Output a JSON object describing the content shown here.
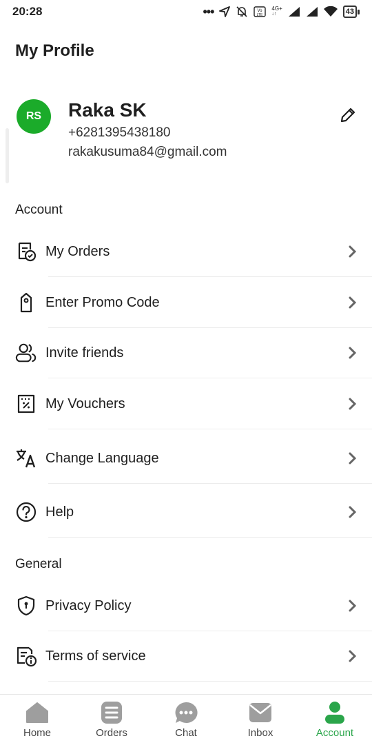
{
  "status_bar": {
    "time": "20:28",
    "battery": "43",
    "network": "4G+"
  },
  "page": {
    "title": "My Profile"
  },
  "profile": {
    "initials": "RS",
    "name": "Raka SK",
    "phone": "+6281395438180",
    "email": "rakakusuma84@gmail.com",
    "avatar_color": "#1bab2a"
  },
  "sections": {
    "account": "Account",
    "general": "General"
  },
  "account_items": [
    {
      "label": "My Orders",
      "icon": "orders-check-icon"
    },
    {
      "label": "Enter Promo Code",
      "icon": "promo-tag-icon"
    },
    {
      "label": "Invite friends",
      "icon": "users-icon"
    },
    {
      "label": "My Vouchers",
      "icon": "voucher-icon"
    },
    {
      "label": "Change Language",
      "icon": "translate-icon"
    },
    {
      "label": "Help",
      "icon": "help-icon"
    }
  ],
  "general_items": [
    {
      "label": "Privacy Policy",
      "icon": "shield-icon"
    },
    {
      "label": "Terms of service",
      "icon": "document-info-icon"
    }
  ],
  "bottom_nav": [
    {
      "label": "Home",
      "icon": "home-icon"
    },
    {
      "label": "Orders",
      "icon": "orders-icon"
    },
    {
      "label": "Chat",
      "icon": "chat-icon"
    },
    {
      "label": "Inbox",
      "icon": "inbox-icon"
    },
    {
      "label": "Account",
      "icon": "account-icon",
      "active": true
    }
  ],
  "colors": {
    "accent": "#2aa54a",
    "nav_icon": "#9e9e9e",
    "text": "#1f1f1f"
  }
}
